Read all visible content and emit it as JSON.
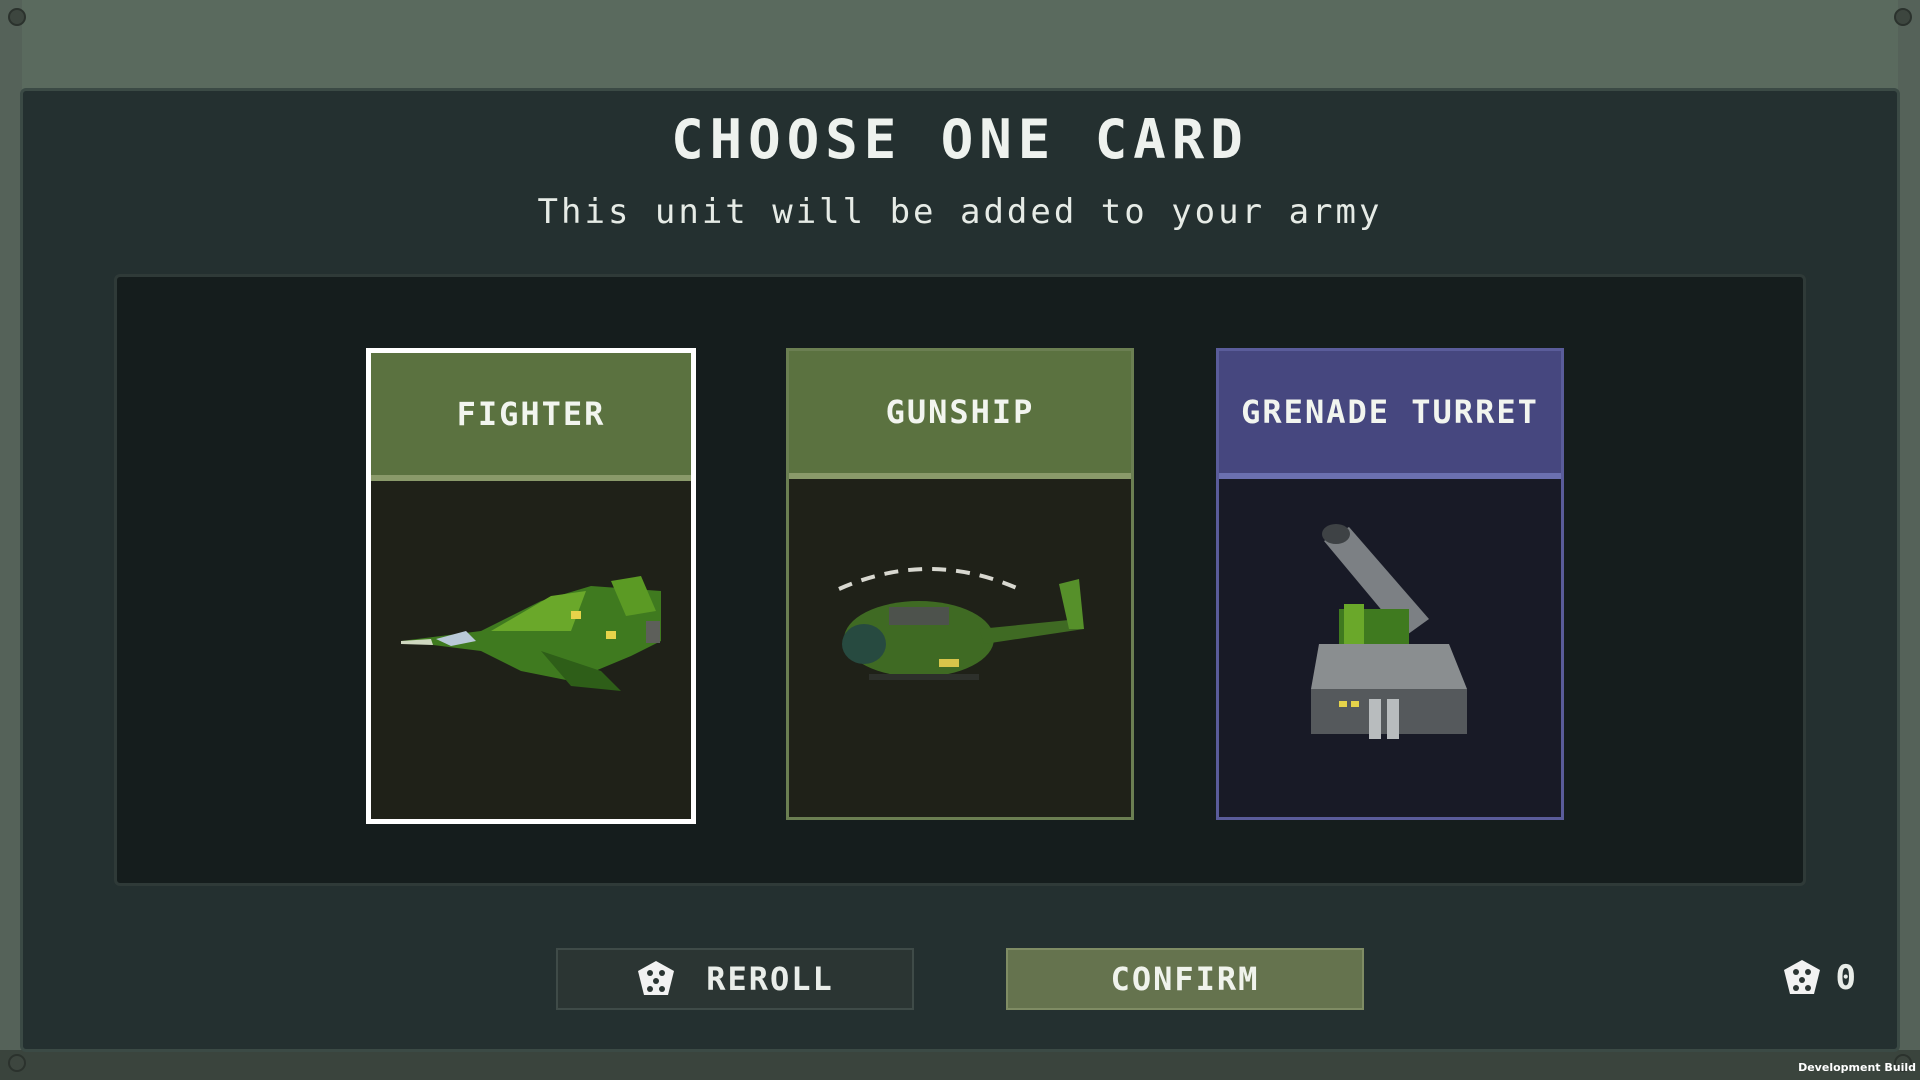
{
  "title": "CHOOSE ONE CARD",
  "subtitle": "This unit will be added to your army",
  "cards": [
    {
      "name": "FIGHTER",
      "selected": true,
      "theme": "green"
    },
    {
      "name": "GUNSHIP",
      "selected": false,
      "theme": "green"
    },
    {
      "name": "GRENADE TURRET",
      "selected": false,
      "theme": "purple"
    }
  ],
  "buttons": {
    "reroll": "REROLL",
    "confirm": "CONFIRM"
  },
  "reroll_count": "0",
  "dev_label": "Development Build",
  "colors": {
    "green_header": "#5b7240",
    "purple_header": "#46477f",
    "confirm_bg": "#65734e",
    "panel_bg": "#243030"
  },
  "icons": {
    "reroll": "dice-icon",
    "counter": "dice-icon"
  }
}
